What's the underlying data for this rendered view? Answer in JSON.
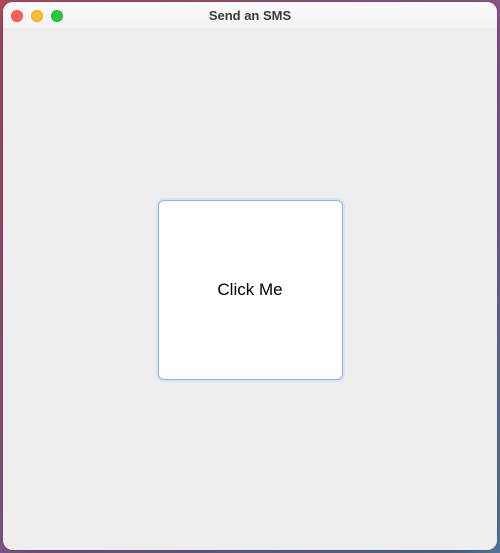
{
  "window": {
    "title": "Send an SMS"
  },
  "main": {
    "button_label": "Click Me"
  }
}
